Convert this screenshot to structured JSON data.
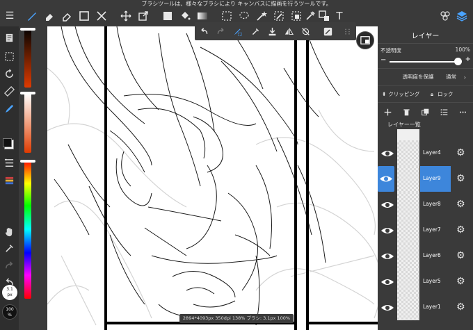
{
  "top_toolbar": {
    "hint": "ブラシツールは、様々なブラシにより キャンバスに描画を行うツールです。",
    "tools": [
      {
        "name": "menu-icon",
        "glyph": "≡"
      },
      {
        "name": "brush-tool-icon",
        "glyph": "✎"
      },
      {
        "name": "eraser-tool-icon",
        "glyph": "◆"
      },
      {
        "name": "blur-eraser-icon",
        "glyph": "◇"
      },
      {
        "name": "shape-tool-icon",
        "glyph": "□"
      },
      {
        "name": "scissors-icon",
        "glyph": "✂"
      },
      {
        "name": "move-tool-icon",
        "glyph": "✥"
      },
      {
        "name": "transform-tool-icon",
        "glyph": "⤢"
      },
      {
        "name": "fill-tool-icon",
        "glyph": "◧"
      },
      {
        "name": "bucket-tool-icon",
        "glyph": "◩"
      },
      {
        "name": "gradient-tool-icon",
        "glyph": "▬"
      },
      {
        "name": "select-rect-icon",
        "glyph": "⬚"
      },
      {
        "name": "lasso-tool-icon",
        "glyph": "⊙"
      },
      {
        "name": "magic-wand-icon",
        "glyph": "✦"
      },
      {
        "name": "select-pen-icon",
        "glyph": "✏"
      },
      {
        "name": "select-eraser-icon",
        "glyph": "⬚"
      },
      {
        "name": "eyedropper-icon",
        "glyph": "⌐"
      },
      {
        "name": "frame-tool-icon",
        "glyph": "⊞"
      },
      {
        "name": "text-tool-icon",
        "glyph": "T"
      },
      {
        "name": "material-icon",
        "glyph": "✤"
      },
      {
        "name": "layers-icon",
        "glyph": "◈"
      }
    ]
  },
  "left_tools": {
    "items": [
      {
        "name": "pages-icon"
      },
      {
        "name": "selection-icon"
      },
      {
        "name": "rotate-icon"
      },
      {
        "name": "ruler-icon"
      },
      {
        "name": "pen-icon"
      }
    ],
    "brush_size": "3.1\npx",
    "opacity": "100\n%"
  },
  "brush_subtools": {
    "items": [
      {
        "name": "undo-icon"
      },
      {
        "name": "redo-icon"
      },
      {
        "name": "brush-settings-icon"
      },
      {
        "name": "eyedropper-sub-icon"
      },
      {
        "name": "import-icon"
      },
      {
        "name": "flip-icon"
      },
      {
        "name": "snap-off-icon"
      },
      {
        "name": "edit-icon"
      },
      {
        "name": "grip-icon"
      }
    ]
  },
  "canvas": {
    "status": "2894*4093px 350dpi 138% ブラシ: 3.1px 100%"
  },
  "layer_panel": {
    "title": "レイヤー",
    "opacity_label": "不透明度",
    "opacity_value": "100%",
    "opacity_level": 1.0,
    "protect_alpha": "透明度を保護",
    "blend_mode": "通常",
    "clipping": "クリッピング",
    "lock": "ロック",
    "list_title": "レイヤー一覧",
    "layers": [
      {
        "name": "Layer4",
        "selected": false
      },
      {
        "name": "Layer9",
        "selected": true
      },
      {
        "name": "Layer8",
        "selected": false
      },
      {
        "name": "Layer7",
        "selected": false
      },
      {
        "name": "Layer6",
        "selected": false
      },
      {
        "name": "Layer5",
        "selected": false
      },
      {
        "name": "Layer1",
        "selected": false
      }
    ]
  },
  "colors": {
    "accent": "#3d86db",
    "active_tool": "#4aa3ff",
    "panel": "#3a3a3a"
  }
}
